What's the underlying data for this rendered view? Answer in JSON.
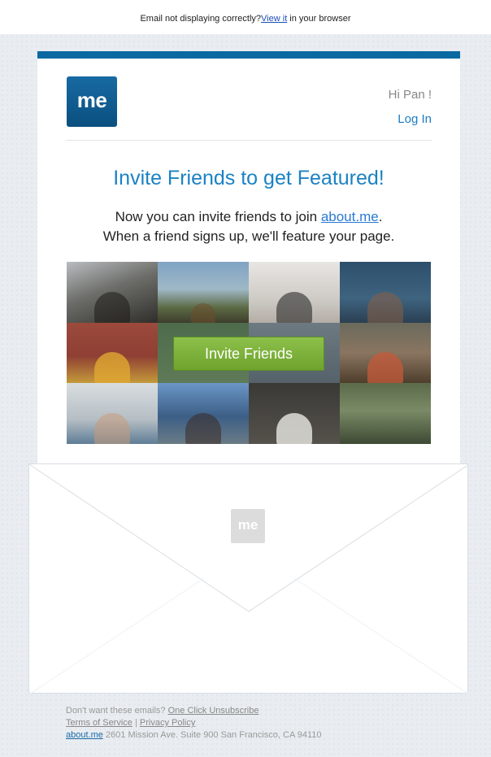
{
  "topbar": {
    "prefix": "Email not displaying correctly?",
    "link": "View it",
    "suffix": " in your browser"
  },
  "header": {
    "logo_text": "me",
    "greeting": "Hi Pan !",
    "login": "Log In"
  },
  "main": {
    "headline": "Invite Friends to get Featured!",
    "sub_line1_prefix": "Now you can invite friends to join ",
    "sub_line1_link": "about.me",
    "sub_line1_suffix": ".",
    "sub_line2": "When a friend signs up, we'll feature your page.",
    "cta": "Invite Friends"
  },
  "envelope": {
    "logo_text": "me"
  },
  "footer": {
    "unsub_prefix": "Don't want these emails? ",
    "unsub_link": "One Click Unsubscribe",
    "terms": "Terms of Service",
    "separator": " | ",
    "privacy": "Privacy Policy",
    "brand_link": "about.me",
    "address": " 2601 Mission Ave. Suite 900 San Francisco, CA 94110"
  },
  "colors": {
    "accent": "#0a69a0",
    "link": "#1b82c4",
    "cta": "#7ab23a"
  }
}
